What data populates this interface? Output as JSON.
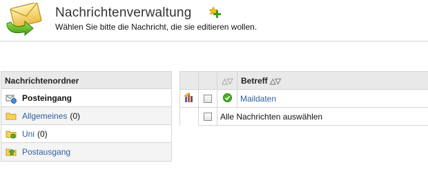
{
  "header": {
    "title": "Nachrichtenverwaltung",
    "subtitle": "Wählen Sie bitte die Nachricht, die sie editieren wollen."
  },
  "sidebar": {
    "heading": "Nachrichtenordner",
    "folders": [
      {
        "label": "Posteingang",
        "count": "",
        "icon": "inbox-icon",
        "active": true
      },
      {
        "label": "Allgemeines",
        "count": "(0)",
        "icon": "folder-icon",
        "active": false
      },
      {
        "label": "Uni",
        "count": "(0)",
        "icon": "folder-gear-icon",
        "active": false
      },
      {
        "label": "Postausgang",
        "count": "",
        "icon": "outbox-icon",
        "active": false
      }
    ]
  },
  "table": {
    "sort_arrows": "△▽",
    "subject_header": "Betreff",
    "rows": [
      {
        "subject": "Maildaten",
        "status_icon": "check-icon",
        "type_icon": "mail-flag-icon"
      }
    ],
    "select_all_label": "Alle Nachrichten auswählen"
  },
  "colors": {
    "link": "#2b5f9e",
    "header_bg": "#e9e9e9",
    "border": "#d4d4d4"
  }
}
